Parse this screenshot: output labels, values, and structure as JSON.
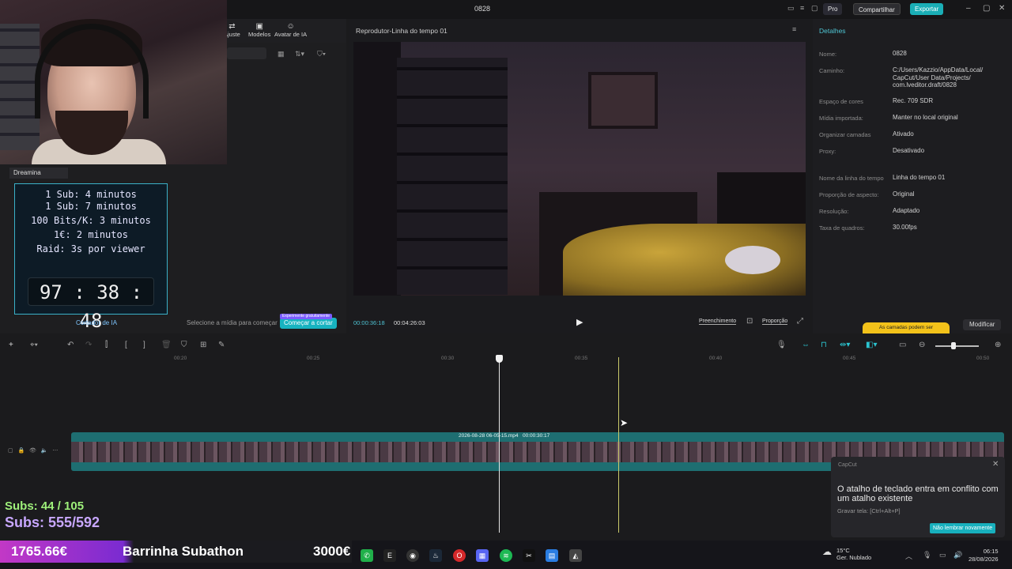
{
  "window": {
    "title": "0828",
    "pro": "Pro",
    "share": "Compartilhar",
    "export": "Exportar"
  },
  "media_tabs": [
    {
      "label": "Ajuste"
    },
    {
      "label": "Modelos"
    },
    {
      "label": "Avatar de IA"
    }
  ],
  "dreamina": "Dreamina",
  "subathon_rules": [
    "1 Sub: 4 minutos",
    "1 Sub: 7 minutos",
    "100 Bits/K: 3 minutos",
    "1€: 2 minutos",
    "Raid: 3s por viewer"
  ],
  "timer": "97 : 38 : 48",
  "cutter": {
    "label": "Cortador de IA",
    "hint": "Selecione a mídia para começar",
    "badge": "Experimente gratuitamente",
    "button": "Começar a cortar"
  },
  "player": {
    "title": "Reprodutor-Linha do tempo 01",
    "current": "00:00:36:18",
    "total": "00:04:26:03",
    "fill": "Preenchimento",
    "ratio": "Proporção"
  },
  "details": {
    "title": "Detalhes",
    "rows": [
      {
        "label": "Nome:",
        "value": "0828"
      },
      {
        "label": "Caminho:",
        "value": "C:/Users/Kazzio/AppData/Local/ CapCut/User Data/Projects/ com.lveditor.draft/0828"
      },
      {
        "label": "Espaço de cores",
        "value": "Rec. 709 SDR"
      },
      {
        "label": "Mídia importada:",
        "value": "Manter no local original"
      },
      {
        "label": "Organizar camadas",
        "value": "Ativado"
      },
      {
        "label": "Proxy:",
        "value": "Desativado"
      },
      {
        "label": "Nome da linha do tempo",
        "value": "Linha do tempo 01"
      },
      {
        "label": "Proporção de aspecto:",
        "value": "Original"
      },
      {
        "label": "Resolução:",
        "value": "Adaptado"
      },
      {
        "label": "Taxa de quadros:",
        "value": "30.00fps"
      }
    ],
    "warning": "As camadas podem ser",
    "modify": "Modificar"
  },
  "ruler": [
    "00:20",
    "00:25",
    "00:30",
    "00:35",
    "00:40",
    "00:45",
    "00:50"
  ],
  "clip": {
    "name": "2026-08-28 06-05-15.mp4",
    "duration": "00:00:30:17"
  },
  "toast": {
    "brand": "CapCut",
    "message": "O atalho de teclado entra em conflito com um atalho existente",
    "sub": "Gravar tela: [Ctrl+Alt+P]",
    "button": "Não lembrar novamente"
  },
  "overlay": {
    "subs_goal": "Subs: 44 / 105",
    "subs_total": "Subs: 555/592"
  },
  "subathon_bar": {
    "value": "1765.66€",
    "name": "Barrinha Subathon",
    "goal": "3000€",
    "progress": 0.59
  },
  "taskbar": {
    "weather_temp": "15°C",
    "weather_desc": "Ger. Nublado",
    "time": "06:15",
    "date": "28/08/2026"
  },
  "colors": {
    "accent": "#1aaeb6",
    "track": "#1e6e71",
    "timer_border": "#3ab1c8"
  }
}
